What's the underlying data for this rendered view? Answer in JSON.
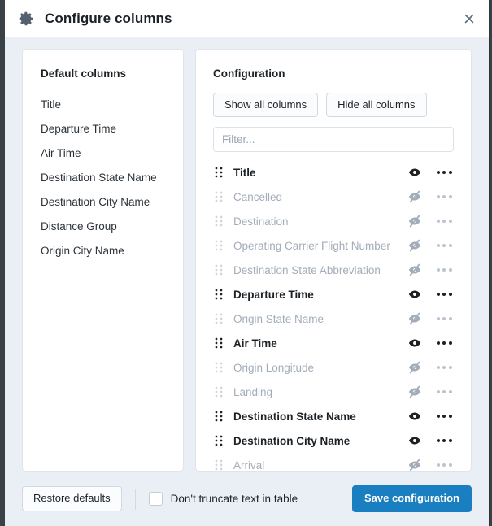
{
  "header": {
    "title": "Configure columns",
    "gear_icon": "gear-icon",
    "close_icon": "close-icon"
  },
  "default_panel": {
    "heading": "Default columns",
    "items": [
      "Title",
      "Departure Time",
      "Air Time",
      "Destination State Name",
      "Destination City Name",
      "Distance Group",
      "Origin City Name"
    ]
  },
  "config_panel": {
    "heading": "Configuration",
    "show_all_label": "Show all columns",
    "hide_all_label": "Hide all columns",
    "filter": {
      "value": "",
      "placeholder": "Filter..."
    },
    "row_icons": {
      "drag_handle": "drag-handle-icon",
      "visible": "eye-icon",
      "hidden": "eye-off-icon",
      "menu": "ellipsis-icon"
    },
    "columns": [
      {
        "label": "Title",
        "visible": true
      },
      {
        "label": "Cancelled",
        "visible": false
      },
      {
        "label": "Destination",
        "visible": false
      },
      {
        "label": "Operating Carrier Flight Number",
        "visible": false
      },
      {
        "label": "Destination State Abbreviation",
        "visible": false
      },
      {
        "label": "Departure Time",
        "visible": true
      },
      {
        "label": "Origin State Name",
        "visible": false
      },
      {
        "label": "Air Time",
        "visible": true
      },
      {
        "label": "Origin Longitude",
        "visible": false
      },
      {
        "label": "Landing",
        "visible": false
      },
      {
        "label": "Destination State Name",
        "visible": true
      },
      {
        "label": "Destination City Name",
        "visible": true
      },
      {
        "label": "Arrival",
        "visible": false
      }
    ]
  },
  "footer": {
    "restore_label": "Restore defaults",
    "truncate_label": "Don't truncate text in table",
    "truncate_checked": false,
    "save_label": "Save configuration"
  },
  "colors": {
    "accent": "#1a7fc1",
    "dialog_background": "#eaeff5",
    "card_background": "#ffffff",
    "text": "#1c2126",
    "muted_text": "#a3adb9"
  }
}
